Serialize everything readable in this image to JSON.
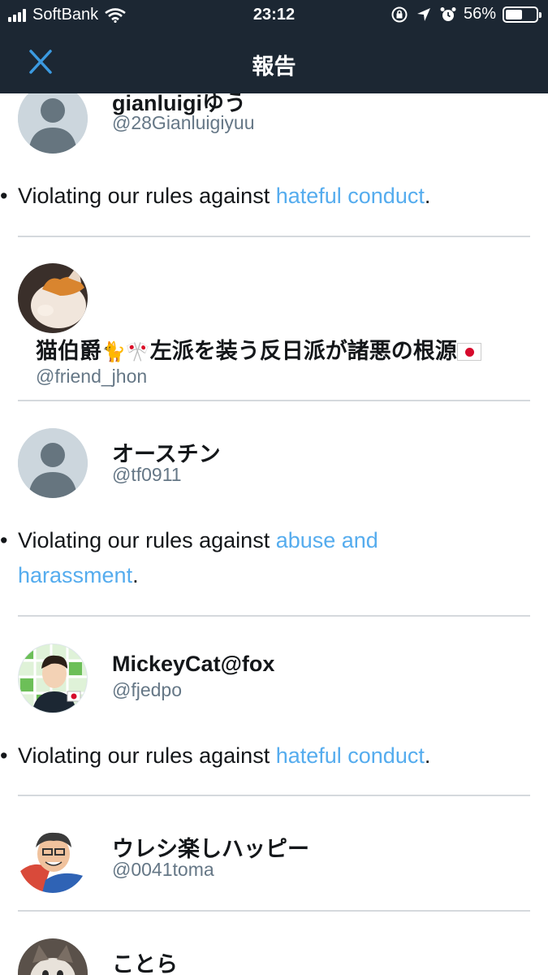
{
  "status": {
    "carrier": "SoftBank",
    "time": "23:12",
    "battery": "56%",
    "battery_level": 0.56
  },
  "nav": {
    "title": "報告",
    "close_icon": "close-icon"
  },
  "reason_prefix": "Violating our rules against ",
  "colors": {
    "bar": "#1c2733",
    "link": "#55acee",
    "handle": "#657786"
  },
  "users": [
    {
      "name": "gianluigiゆう",
      "handle": "@28Gianluigiyuu",
      "avatar": "default-avatar",
      "reason_link": "hateful conduct",
      "reason_end": "."
    },
    {
      "name": "猫伯爵",
      "name_suffix": "左派を装う反日派が諸悪の根源",
      "handle": "@friend_jhon",
      "avatar": "cat-avatar",
      "cat_emoji": "🐈",
      "crossed_flags_emoji": "🎌"
    },
    {
      "name": "オースチン",
      "handle": "@tf0911",
      "avatar": "default-avatar",
      "reason_link": "abuse and harassment",
      "reason_link_line1": "abuse and",
      "reason_link_line2": "harassment",
      "reason_end": "."
    },
    {
      "name": "MickeyCat@fox",
      "handle": "@fjedpo",
      "avatar": "man-avatar",
      "reason_link": "hateful conduct",
      "reason_end": "."
    },
    {
      "name": "ウレシ楽しハッピー",
      "handle": "@0041toma",
      "avatar": "cartoon-avatar"
    },
    {
      "name": "ことら",
      "avatar": "cat-avatar"
    }
  ]
}
